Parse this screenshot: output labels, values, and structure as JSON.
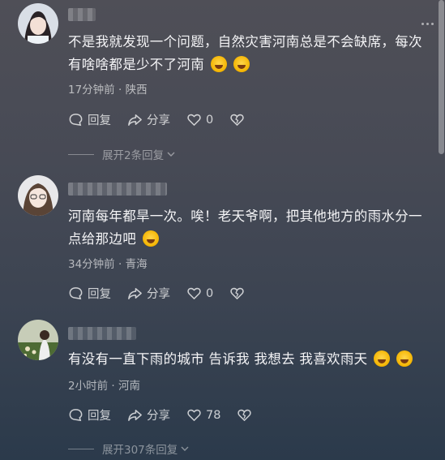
{
  "comments": [
    {
      "text": "不是我就发现一个问题，自然灾害河南总是不会缺席，每次有啥啥都是少不了河南",
      "emoji": [
        "rolling-laughing-emoji",
        "rolling-laughing-emoji"
      ],
      "time": "17分钟前",
      "location": "陕西",
      "reply_label": "回复",
      "share_label": "分享",
      "likes": "0",
      "expand_label": "展开2条回复"
    },
    {
      "text": "河南每年都旱一次。唉！老天爷啊，把其他地方的雨水分一点给那边吧",
      "emoji": [
        "crying-emoji"
      ],
      "time": "34分钟前",
      "location": "青海",
      "reply_label": "回复",
      "share_label": "分享",
      "likes": "0"
    },
    {
      "text": "有没有一直下雨的城市 告诉我 我想去 我喜欢雨天",
      "emoji": [
        "crying-emoji",
        "crying-emoji"
      ],
      "time": "2小时前",
      "location": "河南",
      "reply_label": "回复",
      "share_label": "分享",
      "likes": "78",
      "expand_label": "展开307条回复"
    }
  ],
  "separator": "·"
}
